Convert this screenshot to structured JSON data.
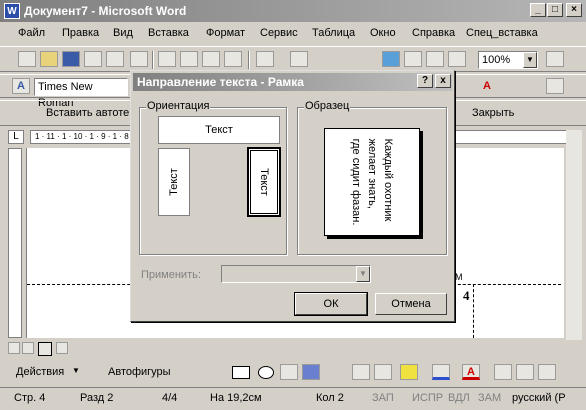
{
  "window": {
    "title": "Документ7 - Microsoft Word",
    "app_icon": "W"
  },
  "menu": [
    "Файл",
    "Правка",
    "Вид",
    "Вставка",
    "Формат",
    "Сервис",
    "Таблица",
    "Окно",
    "Справка",
    "Спец_вставка"
  ],
  "toolbar": {
    "zoom": "100%"
  },
  "format_toolbar": {
    "font": "Times New Roman"
  },
  "frames_toolbar": {
    "insert_label": "Вставить автоте",
    "close_label": "Закрыть"
  },
  "ruler": {
    "top_marks": "1 · 11 · 1 · 10 · 1 · 9 · 1 · 8"
  },
  "document": {
    "page_number": "4",
    "header_fragment": "М"
  },
  "dialog": {
    "title": "Направление текста - Рамка",
    "help": "?",
    "close": "x",
    "orientation_label": "Ориентация",
    "option_horizontal": "Текст",
    "option_vertical_up": "Текст",
    "option_vertical_down": "Текст",
    "preview_label": "Образец",
    "preview_lines": [
      "Каждый охотник",
      "желает знать,",
      "где сидит фазан."
    ],
    "apply_label": "Применить:",
    "apply_value": "",
    "ok": "ОК",
    "cancel": "Отмена"
  },
  "drawing_toolbar": {
    "actions": "Действия",
    "autoshapes": "Автофигуры"
  },
  "status": {
    "page": "Стр. 4",
    "section": "Разд 2",
    "pages": "4/4",
    "at": "На 19,2см",
    "col": "Кол 2",
    "rec": "ЗАП",
    "trk": "ИСПР",
    "ext": "ВДЛ",
    "ovr": "ЗАМ",
    "lang": "русский (Р"
  }
}
